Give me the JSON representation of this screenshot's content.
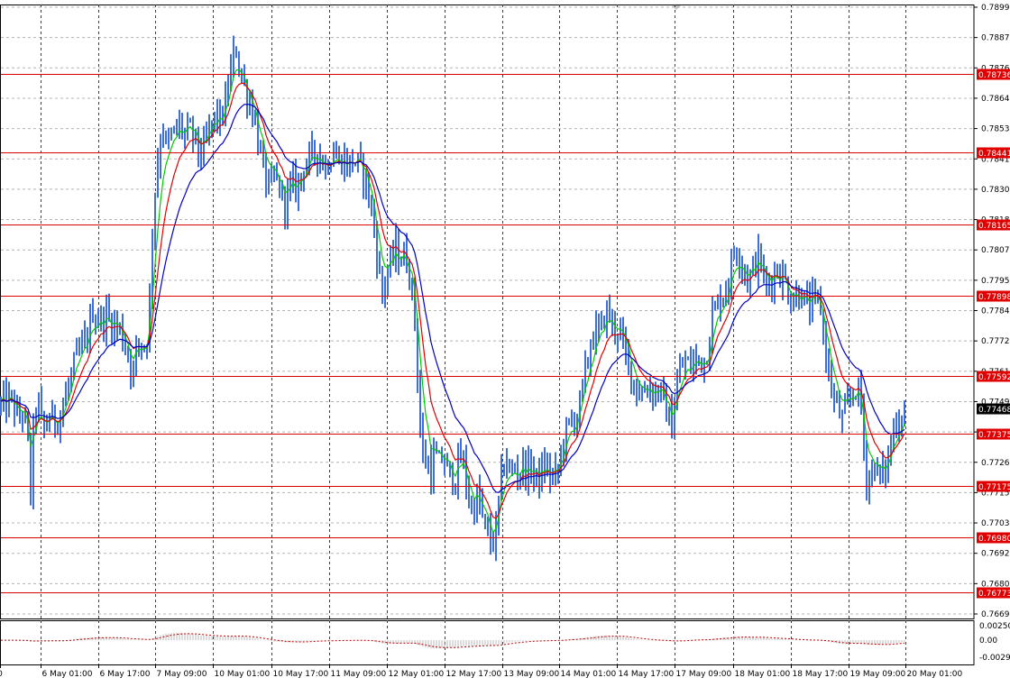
{
  "chart_data": {
    "type": "ohlc",
    "instrument": "",
    "x_labels": [
      "0",
      "6 May 01:00",
      "6 May 17:00",
      "7 May 09:00",
      "10 May 01:00",
      "10 May 17:00",
      "11 May 09:00",
      "12 May 01:00",
      "12 May 17:00",
      "13 May 09:00",
      "14 May 01:00",
      "14 May 17:00",
      "17 May 09:00",
      "18 May 01:00",
      "18 May 17:00",
      "19 May 09:00",
      "20 May 01:00"
    ],
    "price_axis": {
      "min": 0.7669,
      "max": 0.7899,
      "tick_labels": [
        "0.78990",
        "0.78875",
        "0.78760",
        "0.78645",
        "0.78530",
        "0.78415",
        "0.78300",
        "0.78185",
        "0.78070",
        "0.77955",
        "0.77840",
        "0.77725",
        "0.77610",
        "0.77495",
        "0.77380",
        "0.77265",
        "0.77150",
        "0.77035",
        "0.76920",
        "0.76805",
        "0.76690"
      ]
    },
    "current_price": "0.77468",
    "horizontal_levels": [
      "0.78736",
      "0.78441",
      "0.78165",
      "0.77898",
      "0.77592",
      "0.77375",
      "0.77175",
      "0.76980",
      "0.76773"
    ],
    "moving_averages": [
      {
        "color": "#00c800"
      },
      {
        "color": "#e00000"
      },
      {
        "color": "#0000c0"
      }
    ],
    "oscillator": {
      "tick_labels": [
        "0.00250",
        "0.00",
        "-0.00292"
      ],
      "min": -0.00292,
      "max": 0.0025
    },
    "colors": {
      "candle": "#3d6fd6",
      "level": "#e00000",
      "grid": "#b4b4b4",
      "current_tag": "#000000",
      "level_tag": "#e00000"
    },
    "series_keypoints": [
      [
        0,
        0.7748
      ],
      [
        8,
        0.7749
      ],
      [
        14,
        0.775
      ],
      [
        20,
        0.7742
      ],
      [
        25,
        0.7746
      ],
      [
        30,
        0.7738
      ],
      [
        34,
        0.7715
      ],
      [
        38,
        0.7745
      ],
      [
        42,
        0.775
      ],
      [
        48,
        0.7738
      ],
      [
        55,
        0.7744
      ],
      [
        62,
        0.7742
      ],
      [
        70,
        0.7748
      ],
      [
        78,
        0.7758
      ],
      [
        85,
        0.7766
      ],
      [
        95,
        0.7772
      ],
      [
        103,
        0.7784
      ],
      [
        110,
        0.778
      ],
      [
        118,
        0.7782
      ],
      [
        125,
        0.7779
      ],
      [
        132,
        0.7778
      ],
      [
        140,
        0.777
      ],
      [
        148,
        0.776
      ],
      [
        152,
        0.7773
      ],
      [
        158,
        0.777
      ],
      [
        163,
        0.7774
      ],
      [
        166,
        0.7788
      ],
      [
        168,
        0.781
      ],
      [
        172,
        0.783
      ],
      [
        176,
        0.7845
      ],
      [
        180,
        0.7855
      ],
      [
        185,
        0.7845
      ],
      [
        190,
        0.785
      ],
      [
        195,
        0.7852
      ],
      [
        200,
        0.7855
      ],
      [
        205,
        0.785
      ],
      [
        210,
        0.7852
      ],
      [
        215,
        0.785
      ],
      [
        220,
        0.7845
      ],
      [
        225,
        0.7843
      ],
      [
        230,
        0.785
      ],
      [
        235,
        0.7855
      ],
      [
        240,
        0.7858
      ],
      [
        245,
        0.7856
      ],
      [
        250,
        0.7862
      ],
      [
        253,
        0.787
      ],
      [
        256,
        0.7875
      ],
      [
        259,
        0.788
      ],
      [
        262,
        0.7883
      ],
      [
        265,
        0.7878
      ],
      [
        268,
        0.7872
      ],
      [
        272,
        0.7868
      ],
      [
        276,
        0.7864
      ],
      [
        280,
        0.786
      ],
      [
        283,
        0.7855
      ],
      [
        286,
        0.785
      ],
      [
        288,
        0.7842
      ],
      [
        292,
        0.7838
      ],
      [
        296,
        0.7832
      ],
      [
        300,
        0.783
      ],
      [
        305,
        0.7835
      ],
      [
        310,
        0.783
      ],
      [
        315,
        0.7825
      ],
      [
        320,
        0.7828
      ],
      [
        325,
        0.7832
      ],
      [
        330,
        0.783
      ],
      [
        335,
        0.7838
      ],
      [
        340,
        0.784
      ],
      [
        345,
        0.7842
      ],
      [
        350,
        0.7845
      ],
      [
        355,
        0.7843
      ],
      [
        360,
        0.7838
      ],
      [
        365,
        0.7842
      ],
      [
        370,
        0.7845
      ],
      [
        375,
        0.784
      ],
      [
        380,
        0.7842
      ],
      [
        385,
        0.7839
      ],
      [
        390,
        0.7841
      ],
      [
        395,
        0.784
      ],
      [
        400,
        0.7838
      ],
      [
        405,
        0.7835
      ],
      [
        410,
        0.7825
      ],
      [
        415,
        0.7815
      ],
      [
        420,
        0.78
      ],
      [
        424,
        0.779
      ],
      [
        428,
        0.7798
      ],
      [
        432,
        0.78
      ],
      [
        436,
        0.7805
      ],
      [
        440,
        0.7808
      ],
      [
        444,
        0.7803
      ],
      [
        448,
        0.7805
      ],
      [
        452,
        0.7802
      ],
      [
        456,
        0.7795
      ],
      [
        460,
        0.778
      ],
      [
        463,
        0.776
      ],
      [
        466,
        0.774
      ],
      [
        470,
        0.7725
      ],
      [
        474,
        0.7728
      ],
      [
        478,
        0.7722
      ],
      [
        482,
        0.773
      ],
      [
        486,
        0.7725
      ],
      [
        490,
        0.7728
      ],
      [
        495,
        0.7725
      ],
      [
        500,
        0.772
      ],
      [
        505,
        0.7722
      ],
      [
        510,
        0.7728
      ],
      [
        515,
        0.7725
      ],
      [
        520,
        0.7712
      ],
      [
        525,
        0.7708
      ],
      [
        530,
        0.7715
      ],
      [
        535,
        0.7705
      ],
      [
        540,
        0.77
      ],
      [
        545,
        0.7695
      ],
      [
        550,
        0.77
      ],
      [
        554,
        0.7715
      ],
      [
        558,
        0.7725
      ],
      [
        562,
        0.7728
      ],
      [
        566,
        0.772
      ],
      [
        570,
        0.7725
      ],
      [
        575,
        0.7722
      ],
      [
        580,
        0.7726
      ],
      [
        585,
        0.7722
      ],
      [
        590,
        0.7725
      ],
      [
        595,
        0.772
      ],
      [
        600,
        0.7722
      ],
      [
        605,
        0.7725
      ],
      [
        610,
        0.7722
      ],
      [
        615,
        0.772
      ],
      [
        620,
        0.7725
      ],
      [
        625,
        0.7735
      ],
      [
        630,
        0.774
      ],
      [
        635,
        0.7742
      ],
      [
        640,
        0.7745
      ],
      [
        645,
        0.7752
      ],
      [
        650,
        0.7762
      ],
      [
        655,
        0.7772
      ],
      [
        660,
        0.7776
      ],
      [
        665,
        0.7775
      ],
      [
        670,
        0.7782
      ],
      [
        675,
        0.7784
      ],
      [
        680,
        0.7776
      ],
      [
        685,
        0.7778
      ],
      [
        690,
        0.7772
      ],
      [
        695,
        0.7765
      ],
      [
        700,
        0.776
      ],
      [
        705,
        0.7756
      ],
      [
        710,
        0.7752
      ],
      [
        715,
        0.7754
      ],
      [
        720,
        0.7756
      ],
      [
        725,
        0.7752
      ],
      [
        730,
        0.7755
      ],
      [
        735,
        0.775
      ],
      [
        740,
        0.7745
      ],
      [
        745,
        0.774
      ],
      [
        750,
        0.7755
      ],
      [
        755,
        0.7762
      ],
      [
        760,
        0.7765
      ],
      [
        765,
        0.7762
      ],
      [
        770,
        0.7765
      ],
      [
        775,
        0.7766
      ],
      [
        780,
        0.7764
      ],
      [
        785,
        0.777
      ],
      [
        790,
        0.7782
      ],
      [
        795,
        0.7786
      ],
      [
        800,
        0.779
      ],
      [
        805,
        0.7792
      ],
      [
        810,
        0.78
      ],
      [
        815,
        0.7808
      ],
      [
        820,
        0.7806
      ],
      [
        825,
        0.78
      ],
      [
        830,
        0.7795
      ],
      [
        835,
        0.78
      ],
      [
        840,
        0.7805
      ],
      [
        845,
        0.78
      ],
      [
        850,
        0.7792
      ],
      [
        855,
        0.7796
      ],
      [
        860,
        0.78
      ],
      [
        865,
        0.7798
      ],
      [
        870,
        0.7796
      ],
      [
        875,
        0.779
      ],
      [
        880,
        0.7788
      ],
      [
        885,
        0.7792
      ],
      [
        890,
        0.779
      ],
      [
        895,
        0.7785
      ],
      [
        900,
        0.7786
      ],
      [
        905,
        0.7788
      ],
      [
        910,
        0.7785
      ],
      [
        915,
        0.777
      ],
      [
        920,
        0.7758
      ],
      [
        925,
        0.775
      ],
      [
        930,
        0.7745
      ],
      [
        935,
        0.7742
      ],
      [
        940,
        0.7748
      ],
      [
        945,
        0.7752
      ],
      [
        950,
        0.7756
      ],
      [
        955,
        0.7748
      ],
      [
        960,
        0.772
      ],
      [
        965,
        0.7722
      ],
      [
        970,
        0.7726
      ],
      [
        975,
        0.772
      ],
      [
        980,
        0.7722
      ],
      [
        985,
        0.7728
      ],
      [
        990,
        0.7738
      ],
      [
        995,
        0.7743
      ],
      [
        1000,
        0.7745
      ],
      [
        1003,
        0.7746
      ]
    ]
  }
}
